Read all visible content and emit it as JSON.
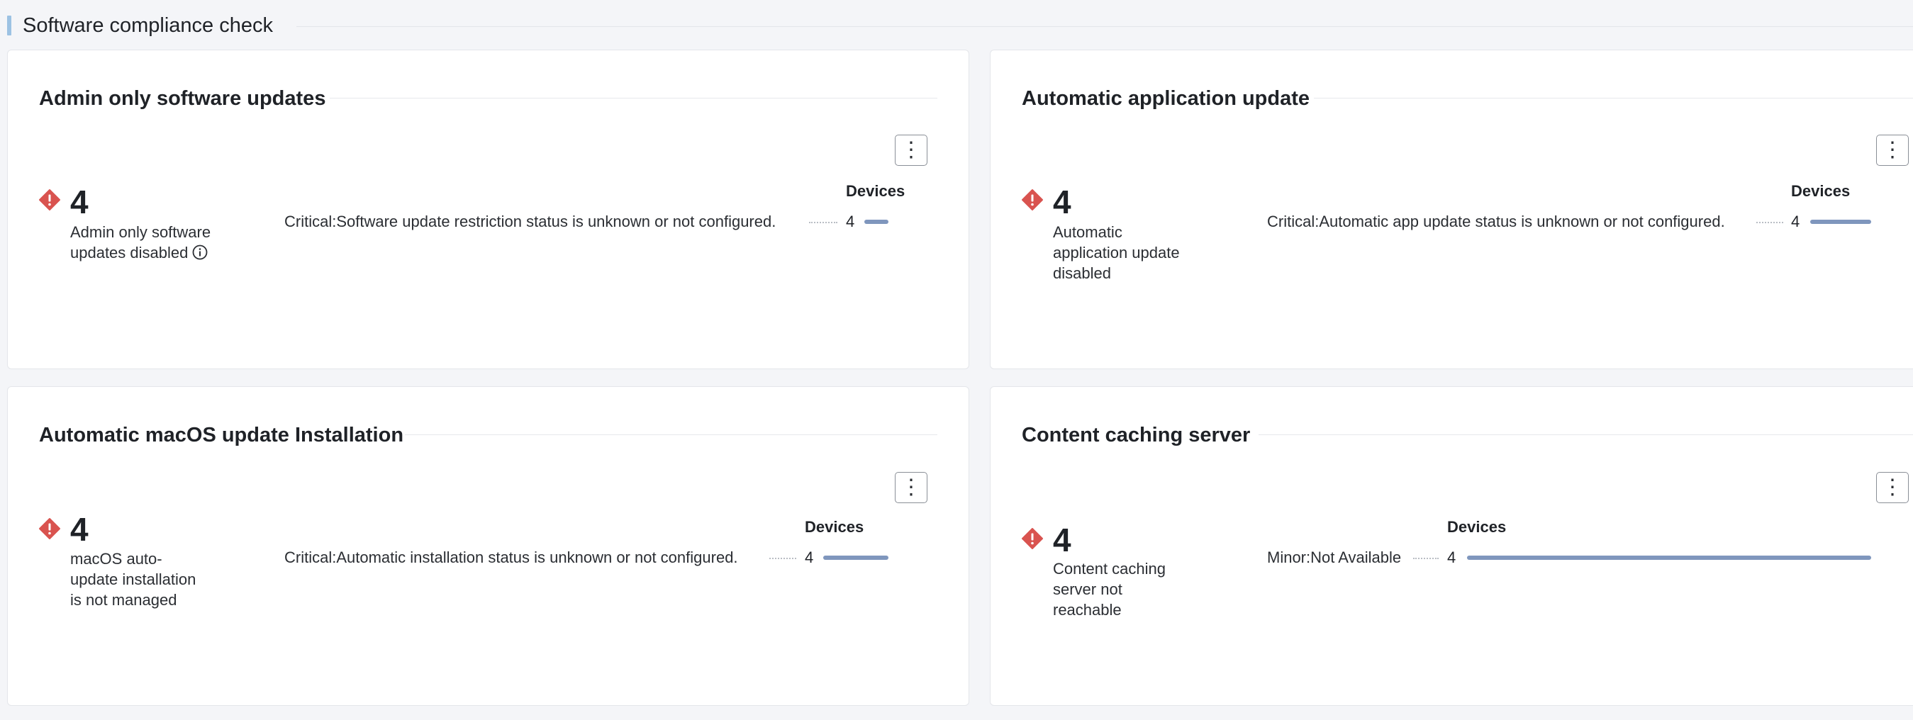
{
  "section": {
    "title": "Software compliance check"
  },
  "cards": [
    {
      "title": "Admin only software updates",
      "count": "4",
      "status_label": "Admin only software updates disabled",
      "has_info_icon": true,
      "devices_header": "Devices",
      "row": {
        "label": "Critical:Software update restriction status is unknown or not configured.",
        "value": "4",
        "bar_fraction": 1.0
      }
    },
    {
      "title": "Automatic application update",
      "count": "4",
      "status_label": "Automatic application update disabled",
      "has_info_icon": false,
      "devices_header": "Devices",
      "row": {
        "label": "Critical:Automatic app update status is unknown or not configured.",
        "value": "4",
        "bar_fraction": 1.0
      }
    },
    {
      "title": "Automatic macOS update Installation",
      "count": "4",
      "status_label": "macOS auto-update installation is not managed",
      "has_info_icon": false,
      "devices_header": "Devices",
      "row": {
        "label": "Critical:Automatic installation status is unknown or not configured.",
        "value": "4",
        "bar_fraction": 1.0
      }
    },
    {
      "title": "Content caching server",
      "count": "4",
      "status_label": "Content caching server not reachable",
      "has_info_icon": false,
      "devices_header": "Devices",
      "row": {
        "label": "Minor:Not Available",
        "value": "4",
        "bar_fraction": 1.0
      }
    }
  ],
  "colors": {
    "critical": "#d9534f",
    "bar": "#7f96bd",
    "accent": "#9cc2e3"
  },
  "icons": {
    "status": "critical-diamond-icon",
    "menu": "kebab-menu-icon",
    "info": "info-circle-icon"
  }
}
